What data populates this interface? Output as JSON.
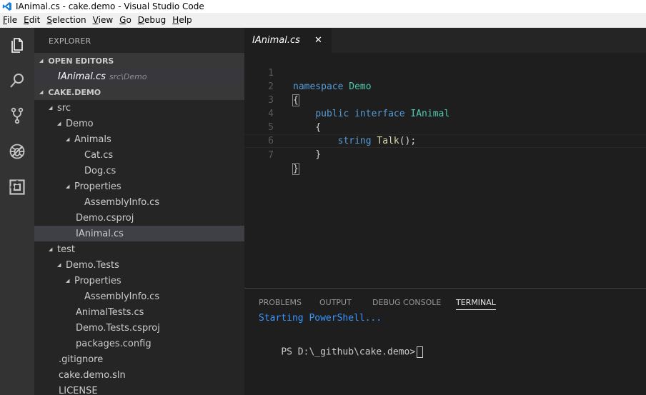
{
  "window": {
    "title": "IAnimal.cs - cake.demo - Visual Studio Code"
  },
  "menu": [
    {
      "u": "F",
      "rest": "ile"
    },
    {
      "u": "E",
      "rest": "dit"
    },
    {
      "u": "S",
      "rest": "election"
    },
    {
      "u": "V",
      "rest": "iew"
    },
    {
      "u": "G",
      "rest": "o"
    },
    {
      "u": "D",
      "rest": "ebug"
    },
    {
      "u": "H",
      "rest": "elp"
    }
  ],
  "activity": {
    "icons": [
      "files-icon",
      "search-icon",
      "source-control-icon",
      "debug-icon",
      "extensions-icon"
    ],
    "icon_color": "#c5c5c5"
  },
  "sidebar": {
    "title": "EXPLORER",
    "open_editors": {
      "label": "OPEN EDITORS",
      "items": [
        {
          "name": "IAnimal.cs",
          "path": "src\\Demo"
        }
      ]
    },
    "project": {
      "label": "CAKE.DEMO",
      "tree": [
        {
          "label": "src"
        },
        {
          "label": "Demo"
        },
        {
          "label": "Animals"
        },
        {
          "label": "Cat.cs"
        },
        {
          "label": "Dog.cs"
        },
        {
          "label": "Properties"
        },
        {
          "label": "AssemblyInfo.cs"
        },
        {
          "label": "Demo.csproj"
        },
        {
          "label": "IAnimal.cs"
        },
        {
          "label": "test"
        },
        {
          "label": "Demo.Tests"
        },
        {
          "label": "Properties"
        },
        {
          "label": "AssemblyInfo.cs"
        },
        {
          "label": "AnimalTests.cs"
        },
        {
          "label": "Demo.Tests.csproj"
        },
        {
          "label": "packages.config"
        },
        {
          "label": ".gitignore"
        },
        {
          "label": "cake.demo.sln"
        },
        {
          "label": "LICENSE"
        }
      ]
    }
  },
  "editor": {
    "tab": {
      "label": "IAnimal.cs",
      "close": "✕"
    },
    "line_numbers": [
      "1",
      "2",
      "3",
      "4",
      "5",
      "6",
      "7"
    ],
    "code": {
      "l1_kw": "namespace",
      "l1_ty": "Demo",
      "l2": "{",
      "l3_kw1": "public",
      "l3_kw2": "interface",
      "l3_ty": "IAnimal",
      "l4": "{",
      "l5_kw": "string",
      "l5_fn": "Talk",
      "l5_rest": "();",
      "l6": "}",
      "l7": "}"
    }
  },
  "panel": {
    "tabs": [
      "PROBLEMS",
      "OUTPUT",
      "DEBUG CONSOLE",
      "TERMINAL"
    ],
    "terminal": {
      "line1": "Starting PowerShell...",
      "prompt": "PS D:\\_github\\cake.demo>"
    }
  },
  "colors": {
    "keyword": "#569cd6",
    "type": "#4ec9b0",
    "function": "#dcdcaa",
    "terminal_info": "#3794ff"
  }
}
